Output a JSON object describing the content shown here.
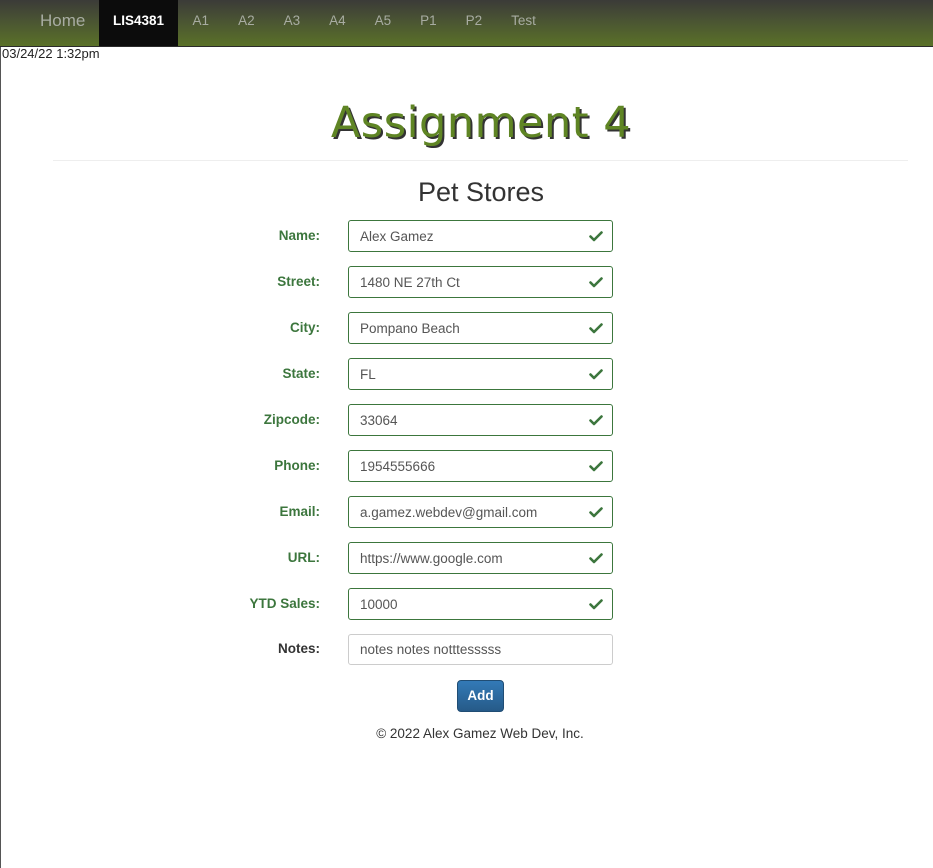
{
  "nav": {
    "brand": "Home",
    "items": [
      "LIS4381",
      "A1",
      "A2",
      "A3",
      "A4",
      "A5",
      "P1",
      "P2",
      "Test"
    ],
    "active_index": 0
  },
  "timestamp": "03/24/22 1:32pm",
  "header": {
    "title": "Assignment 4"
  },
  "form": {
    "title": "Pet Stores",
    "fields": [
      {
        "label": "Name:",
        "value": "Alex Gamez",
        "valid": true
      },
      {
        "label": "Street:",
        "value": "1480 NE 27th Ct",
        "valid": true
      },
      {
        "label": "City:",
        "value": "Pompano Beach",
        "valid": true
      },
      {
        "label": "State:",
        "value": "FL",
        "valid": true
      },
      {
        "label": "Zipcode:",
        "value": "33064",
        "valid": true
      },
      {
        "label": "Phone:",
        "value": "1954555666",
        "valid": true
      },
      {
        "label": "Email:",
        "value": "a.gamez.webdev@gmail.com",
        "valid": true
      },
      {
        "label": "URL:",
        "value": "https://www.google.com",
        "valid": true
      },
      {
        "label": "YTD Sales:",
        "value": "10000",
        "valid": true
      },
      {
        "label": "Notes:",
        "value": "notes notes notttesssss",
        "valid": false
      }
    ],
    "submit_label": "Add"
  },
  "footer": {
    "text": "© 2022 Alex Gamez Web Dev, Inc."
  },
  "colors": {
    "success": "#3c763d",
    "header_green": "#5f8524",
    "button_blue": "#337ab7"
  },
  "icons": {
    "valid_field": "check-icon"
  }
}
